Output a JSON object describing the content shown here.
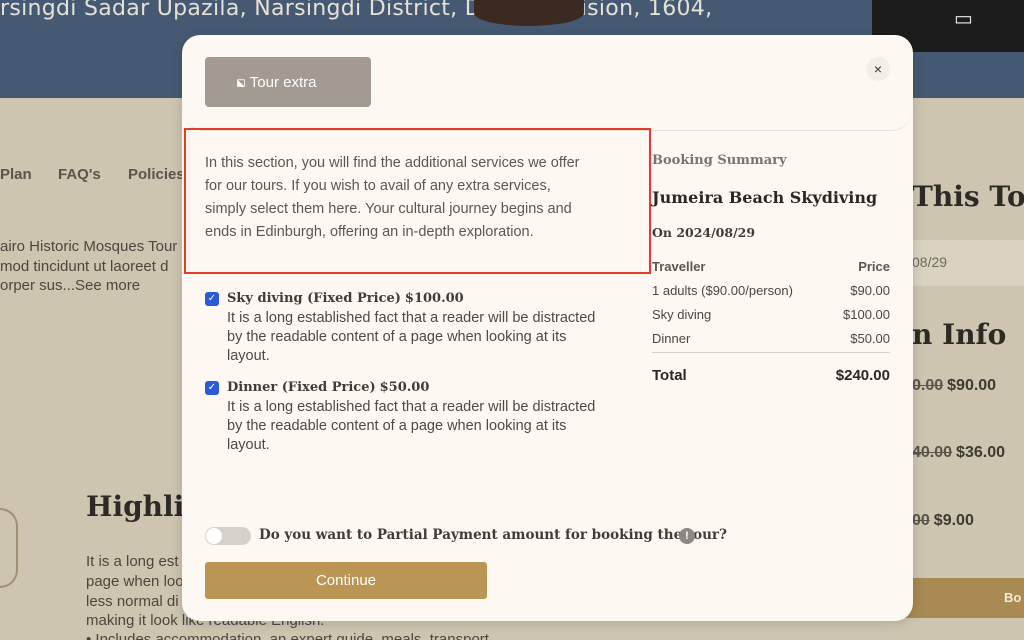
{
  "background": {
    "address": "rsingdi Sadar Upazila, Narsingdi District, Dhaka Division, 1604,",
    "nav": [
      "Plan",
      "FAQ's",
      "Policies"
    ],
    "text_lines": [
      "airo Historic Mosques Tour",
      "mod tincidunt ut laoreet d",
      "orper sus...See more"
    ],
    "highlights_heading": "Highligh",
    "para_lines": [
      "It is a long est",
      "page when loo",
      "less normal di",
      "making it look like readable English.",
      "• Includes accommodation, an expert guide, meals, transport"
    ],
    "right_title": "This Tour",
    "date_value": "08/29",
    "info_heading": "n Info",
    "prices": [
      {
        "old": "0.00",
        "new": "$90.00"
      },
      {
        "old": "40.00",
        "new": "$36.00"
      },
      {
        "old": "00",
        "new": "$9.00"
      }
    ],
    "book_label": "Bo"
  },
  "modal": {
    "tab_label": "Tour extra",
    "close_label": "×",
    "description": "In this section, you will find the additional services we offer for our tours. If you wish to avail of any extra services, simply select them here. Your cultural journey begins and ends in Edinburgh, offering an in-depth exploration.",
    "services": [
      {
        "title": "Sky diving (Fixed Price)",
        "price": "$100.00",
        "checked": true,
        "body": "It is a long established fact that a reader will be distracted by the readable content of a page when looking at its layout."
      },
      {
        "title": "Dinner (Fixed Price)",
        "price": "$50.00",
        "checked": true,
        "body": "It is a long established fact that a reader will be distracted by the readable content of a page when looking at its layout."
      }
    ],
    "partial_payment_label": "Do you want to Partial Payment amount for booking the tour?",
    "partial_payment_enabled": false,
    "continue_label": "Continue"
  },
  "summary": {
    "title": "Booking Summary",
    "tour_name": "Jumeira Beach Skydiving",
    "date": "On 2024/08/29",
    "head_left": "Traveller",
    "head_right": "Price",
    "rows": [
      {
        "label": "1 adults ($90.00/person)",
        "price": "$90.00"
      },
      {
        "label": "Sky diving",
        "price": "$100.00"
      },
      {
        "label": "Dinner",
        "price": "$50.00"
      }
    ],
    "total_label": "Total",
    "total_value": "$240.00"
  },
  "colors": {
    "accent": "#bb9553",
    "tab_bg": "#a39a92",
    "highlight_border": "#e23d2c",
    "checkbox": "#2b5cd6"
  },
  "icons": [
    "tag-icon",
    "close-icon",
    "check-icon",
    "info-icon",
    "video-icon"
  ]
}
